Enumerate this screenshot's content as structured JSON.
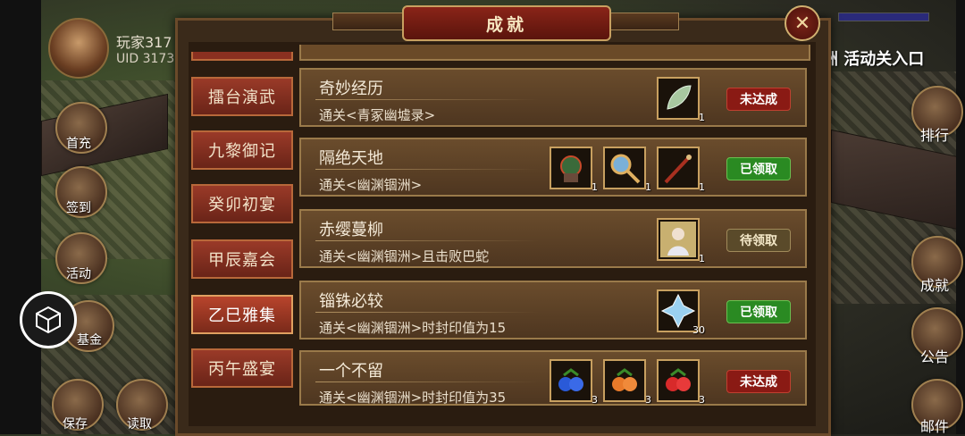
{
  "player": {
    "name": "玩家317",
    "uid": "UID  3173"
  },
  "left_menu": [
    {
      "label": "首充",
      "icon": "gift-icon"
    },
    {
      "label": "签到",
      "icon": "calendar-icon"
    },
    {
      "label": "活动",
      "icon": "flag-icon"
    },
    {
      "label": "基金",
      "icon": "coin-icon"
    },
    {
      "label": "保存",
      "icon": "save-icon"
    },
    {
      "label": "读取",
      "icon": "load-icon"
    }
  ],
  "right_menu": [
    {
      "label": "排行",
      "icon": "ranking-icon"
    },
    {
      "label": "成就",
      "icon": "achievement-icon"
    },
    {
      "label": "公告",
      "icon": "scroll-icon"
    },
    {
      "label": "邮件",
      "icon": "mail-icon"
    }
  ],
  "event_entry": "洲 活动关入口",
  "panel": {
    "title": "成就"
  },
  "tabs": [
    {
      "label": "擂台演武",
      "active": false
    },
    {
      "label": "九黎御记",
      "active": false
    },
    {
      "label": "癸卯初宴",
      "active": false
    },
    {
      "label": "甲辰嘉会",
      "active": false
    },
    {
      "label": "乙巳雅集",
      "active": true
    },
    {
      "label": "丙午盛宴",
      "active": false
    }
  ],
  "achievements": [
    {
      "title": "奇妙经历",
      "desc": "通关<青冢幽墟录>",
      "rewards": [
        {
          "icon": "leaf-icon",
          "count": "1"
        }
      ],
      "status": "未达成",
      "status_color": "red"
    },
    {
      "title": "隔绝天地",
      "desc": "通关<幽渊锢洲>",
      "rewards": [
        {
          "icon": "armor-icon",
          "count": "1"
        },
        {
          "icon": "mirror-icon",
          "count": "1"
        },
        {
          "icon": "staff-icon",
          "count": "1"
        }
      ],
      "status": "已领取",
      "status_color": "green"
    },
    {
      "title": "赤缨蔓柳",
      "desc": "通关<幽渊锢洲>且击败巴蛇",
      "rewards": [
        {
          "icon": "character-portrait-icon",
          "count": "1"
        }
      ],
      "status": "待领取",
      "status_color": "olive"
    },
    {
      "title": "锱铢必较",
      "desc": "通关<幽渊锢洲>时封印值为15",
      "rewards": [
        {
          "icon": "crystal-icon",
          "count": "30"
        }
      ],
      "status": "已领取",
      "status_color": "green"
    },
    {
      "title": "一个不留",
      "desc": "通关<幽渊锢洲>时封印值为35",
      "rewards": [
        {
          "icon": "blue-fruit-icon",
          "count": "3"
        },
        {
          "icon": "orange-fruit-icon",
          "count": "3"
        },
        {
          "icon": "red-fruit-icon",
          "count": "3"
        }
      ],
      "status": "未达成",
      "status_color": "red"
    }
  ]
}
